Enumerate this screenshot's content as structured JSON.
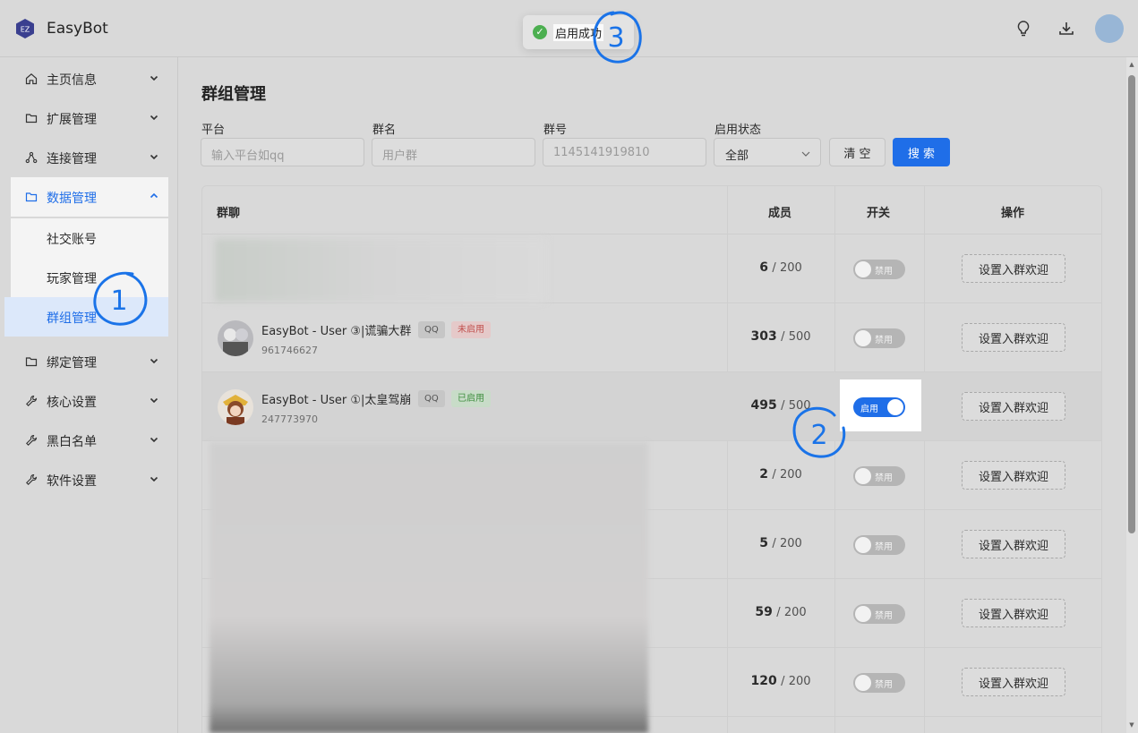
{
  "app": {
    "logo_text": "EZ",
    "title": "EasyBot"
  },
  "toast": {
    "text": "启用成功"
  },
  "sidebar": {
    "items": [
      {
        "label": "主页信息"
      },
      {
        "label": "扩展管理"
      },
      {
        "label": "连接管理"
      },
      {
        "label": "数据管理"
      },
      {
        "label": "绑定管理"
      },
      {
        "label": "核心设置"
      },
      {
        "label": "黑白名单"
      },
      {
        "label": "软件设置"
      }
    ],
    "data_submenu": [
      {
        "label": "社交账号"
      },
      {
        "label": "玩家管理"
      },
      {
        "label": "群组管理"
      }
    ]
  },
  "page": {
    "title": "群组管理"
  },
  "filters": {
    "platform_label": "平台",
    "platform_placeholder": "输入平台如qq",
    "group_name_label": "群名",
    "group_name_placeholder": "用户群",
    "group_id_label": "群号",
    "group_id_placeholder": "1145141919810",
    "status_label": "启用状态",
    "status_value": "全部",
    "clear_label": "清 空",
    "search_label": "搜 索"
  },
  "table": {
    "headers": {
      "group": "群聊",
      "members": "成员",
      "switch": "开关",
      "action": "操作"
    },
    "rows": [
      {
        "name": "",
        "id": "",
        "platform": "",
        "status": "",
        "members": "6",
        "capacity": "200",
        "switch": "禁用",
        "enabled": false,
        "action": "设置入群欢迎"
      },
      {
        "name": "EasyBot - User ③|谎骗大群",
        "id": "961746627",
        "platform": "QQ",
        "status": "未启用",
        "members": "303",
        "capacity": "500",
        "switch": "禁用",
        "enabled": false,
        "action": "设置入群欢迎"
      },
      {
        "name": "EasyBot - User ①|太皇驾崩",
        "id": "247773970",
        "platform": "QQ",
        "status": "已启用",
        "members": "495",
        "capacity": "500",
        "switch": "启用",
        "enabled": true,
        "action": "设置入群欢迎"
      },
      {
        "name": "",
        "id": "",
        "platform": "",
        "status": "",
        "members": "2",
        "capacity": "200",
        "switch": "禁用",
        "enabled": false,
        "action": "设置入群欢迎"
      },
      {
        "name": "",
        "id": "",
        "platform": "",
        "status": "",
        "members": "5",
        "capacity": "200",
        "switch": "禁用",
        "enabled": false,
        "action": "设置入群欢迎"
      },
      {
        "name": "",
        "id": "",
        "platform": "",
        "status": "",
        "members": "59",
        "capacity": "200",
        "switch": "禁用",
        "enabled": false,
        "action": "设置入群欢迎"
      },
      {
        "name": "",
        "id": "",
        "platform": "",
        "status": "",
        "members": "120",
        "capacity": "200",
        "switch": "禁用",
        "enabled": false,
        "action": "设置入群欢迎"
      }
    ]
  },
  "annotations": {
    "mark_1": "1",
    "mark_2": "2",
    "mark_3": "3"
  },
  "colors": {
    "primary": "#1f6ee8",
    "success": "#4caf50",
    "danger": "#c0504d",
    "annotation": "#1a73e8"
  }
}
